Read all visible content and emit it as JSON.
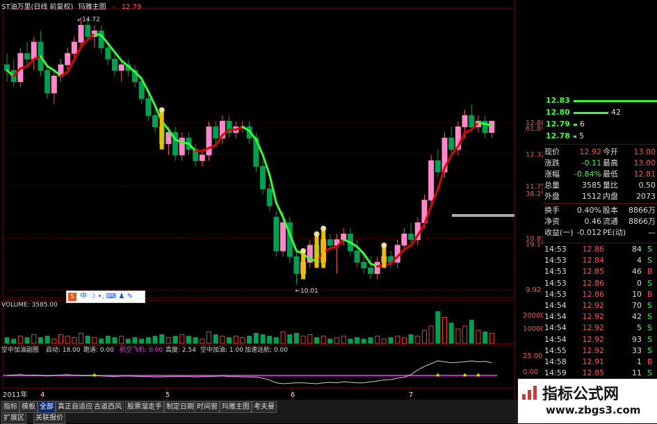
{
  "header": {
    "stock_name": "ST油万里(日线 前复权)",
    "indicator": "玛雅主图",
    "price_readout": "12.79"
  },
  "colors": {
    "up": "#ff3232",
    "down": "#00a050",
    "up_hollow": "#ff5555",
    "ma_up": "#e00000",
    "ma_down": "#33ff33",
    "grid": "#7a0000"
  },
  "chart_data": [
    {
      "type": "candlestick",
      "title": "玛雅主图",
      "y_ticks": [
        "12.88",
        "12.32",
        "11.75",
        "10.83",
        "9.92"
      ],
      "fib_labels": [
        "61.8%",
        "38.2%",
        "19.1%"
      ],
      "annotations": [
        "14.72",
        "10.01"
      ],
      "x_tick_labels": [
        "2011年",
        "4",
        "5",
        "6",
        "7"
      ],
      "ylim": [
        9.75,
        14.9
      ],
      "candles": [
        [
          13.9,
          14.1,
          13.6,
          13.8
        ],
        [
          13.8,
          14.0,
          13.5,
          13.6
        ],
        [
          13.6,
          14.2,
          13.5,
          14.1
        ],
        [
          14.1,
          14.3,
          13.9,
          14.0
        ],
        [
          14.0,
          14.4,
          13.8,
          14.3
        ],
        [
          14.3,
          14.5,
          13.7,
          13.8
        ],
        [
          13.8,
          13.9,
          13.3,
          13.4
        ],
        [
          13.4,
          13.8,
          13.2,
          13.7
        ],
        [
          13.7,
          14.0,
          13.6,
          13.9
        ],
        [
          13.9,
          14.2,
          13.8,
          14.1
        ],
        [
          14.1,
          14.4,
          14.0,
          14.3
        ],
        [
          14.3,
          14.72,
          14.2,
          14.6
        ],
        [
          14.6,
          14.7,
          14.3,
          14.4
        ],
        [
          14.4,
          14.6,
          14.2,
          14.5
        ],
        [
          14.5,
          14.6,
          14.1,
          14.2
        ],
        [
          14.2,
          14.3,
          13.9,
          14.0
        ],
        [
          14.0,
          14.1,
          13.7,
          13.8
        ],
        [
          13.8,
          14.0,
          13.6,
          13.9
        ],
        [
          13.9,
          14.0,
          13.7,
          13.8
        ],
        [
          13.8,
          13.9,
          13.5,
          13.6
        ],
        [
          13.6,
          13.7,
          13.2,
          13.3
        ],
        [
          13.3,
          13.4,
          12.9,
          13.0
        ],
        [
          13.0,
          13.2,
          12.7,
          12.8
        ],
        [
          12.8,
          13.0,
          12.4,
          12.5
        ],
        [
          12.5,
          12.8,
          12.3,
          12.7
        ],
        [
          12.7,
          12.8,
          12.2,
          12.3
        ],
        [
          12.3,
          12.7,
          12.2,
          12.6
        ],
        [
          12.6,
          12.7,
          12.3,
          12.4
        ],
        [
          12.4,
          12.5,
          12.1,
          12.2
        ],
        [
          12.2,
          12.4,
          12.1,
          12.3
        ],
        [
          12.3,
          12.9,
          12.2,
          12.8
        ],
        [
          12.8,
          12.9,
          12.5,
          12.6
        ],
        [
          12.6,
          13.0,
          12.5,
          12.9
        ],
        [
          12.9,
          13.0,
          12.6,
          12.7
        ],
        [
          12.7,
          12.9,
          12.6,
          12.8
        ],
        [
          12.8,
          12.9,
          12.7,
          12.8
        ],
        [
          12.8,
          12.9,
          12.5,
          12.6
        ],
        [
          12.6,
          12.7,
          12.0,
          12.1
        ],
        [
          12.1,
          12.2,
          11.6,
          11.7
        ],
        [
          11.7,
          11.8,
          11.3,
          11.4
        ],
        [
          11.2,
          11.3,
          10.5,
          10.6
        ],
        [
          10.6,
          11.3,
          10.5,
          11.1
        ],
        [
          11.1,
          11.2,
          10.4,
          10.5
        ],
        [
          10.5,
          10.6,
          10.01,
          10.2
        ],
        [
          10.2,
          10.5,
          10.1,
          10.4
        ],
        [
          10.4,
          10.8,
          10.3,
          10.7
        ],
        [
          10.7,
          10.8,
          10.3,
          10.4
        ],
        [
          10.4,
          10.9,
          10.3,
          10.8
        ],
        [
          10.8,
          10.9,
          10.6,
          10.7
        ],
        [
          10.7,
          10.9,
          10.2,
          10.8
        ],
        [
          10.8,
          11.0,
          10.7,
          10.9
        ],
        [
          10.9,
          11.0,
          10.5,
          10.6
        ],
        [
          10.6,
          10.8,
          10.3,
          10.4
        ],
        [
          10.4,
          10.6,
          10.2,
          10.3
        ],
        [
          10.3,
          10.5,
          10.1,
          10.2
        ],
        [
          10.2,
          10.5,
          10.1,
          10.4
        ],
        [
          10.4,
          10.6,
          10.3,
          10.5
        ],
        [
          10.5,
          10.6,
          10.3,
          10.4
        ],
        [
          10.4,
          10.8,
          10.3,
          10.7
        ],
        [
          10.7,
          11.0,
          10.6,
          10.9
        ],
        [
          10.9,
          11.1,
          10.7,
          10.8
        ],
        [
          10.8,
          11.2,
          10.7,
          11.1
        ],
        [
          11.1,
          11.6,
          11.0,
          11.5
        ],
        [
          11.5,
          12.3,
          11.4,
          12.2
        ],
        [
          12.2,
          12.4,
          11.9,
          12.0
        ],
        [
          12.0,
          12.7,
          11.9,
          12.6
        ],
        [
          12.6,
          12.8,
          12.3,
          12.4
        ],
        [
          12.4,
          12.9,
          12.3,
          12.8
        ],
        [
          12.8,
          13.1,
          12.6,
          13.0
        ],
        [
          13.0,
          13.2,
          12.7,
          12.8
        ],
        [
          12.8,
          13.0,
          12.7,
          12.9
        ],
        [
          12.9,
          13.0,
          12.6,
          12.7
        ],
        [
          12.7,
          12.9,
          12.6,
          12.9
        ]
      ],
      "volume": [
        4,
        3,
        5,
        4,
        6,
        4,
        5,
        3,
        6,
        5,
        4,
        7,
        5,
        4,
        3,
        5,
        4,
        5,
        3,
        4,
        3,
        4,
        5,
        6,
        4,
        5,
        6,
        5,
        4,
        3,
        8,
        6,
        5,
        4,
        5,
        4,
        5,
        7,
        6,
        5,
        4,
        8,
        6,
        7,
        5,
        6,
        4,
        5,
        3,
        4,
        5,
        3,
        4,
        3,
        4,
        5,
        3,
        4,
        5,
        4,
        6,
        5,
        9,
        12,
        22,
        18,
        14,
        10,
        12,
        16,
        9,
        8,
        7
      ],
      "volume_panel": {
        "label": "VOLUME: 3585.00",
        "ticks": [
          "20000",
          "10000"
        ]
      },
      "indicator_panel": {
        "title": "空中加油副图",
        "labels": [
          "启动: 18.00",
          "跑道: 0.00",
          "航空飞机: 0.00",
          "高度: 2.54",
          "空中加油: 1.00",
          "加速远航: 0.00"
        ],
        "ticks": [
          "25.00",
          "0.00"
        ],
        "line": [
          2,
          2.5,
          3,
          2,
          2.5,
          2,
          1.5,
          2,
          2.5,
          3,
          2.2,
          2,
          1.8,
          2,
          1.5,
          1.2,
          1,
          1.3,
          1.5,
          1.2,
          1,
          0.8,
          0.5,
          0.6,
          0.8,
          1,
          1.2,
          0.8,
          0.5,
          0.7,
          1,
          1.2,
          1.5,
          1,
          0.8,
          0.6,
          0.5,
          0.3,
          -1,
          -3,
          -6,
          -7,
          -6.5,
          -6,
          -6,
          -6.5,
          -7,
          -6,
          -5.5,
          -6,
          -5,
          -5.5,
          -6,
          -6,
          -5,
          -4,
          -3,
          -2.5,
          -1,
          0,
          3,
          8,
          12,
          15,
          18,
          17,
          16,
          16.5,
          17,
          18,
          17,
          17.5,
          16
        ]
      }
    }
  ],
  "quote": {
    "orderbook": [
      {
        "price": "12.83",
        "vol": "93",
        "w": 120
      },
      {
        "price": "12.80",
        "vol": "42",
        "w": 50
      },
      {
        "price": "12.79",
        "vol": "6",
        "w": 5
      },
      {
        "price": "12.78",
        "vol": "5",
        "w": 4
      }
    ],
    "stats": [
      [
        "现价",
        "12.92",
        "今开",
        "13.00"
      ],
      [
        "涨跌",
        "-0.11",
        "最高",
        "13.00"
      ],
      [
        "涨幅",
        "-0.84%",
        "最低",
        "12.81"
      ],
      [
        "总量",
        "3585",
        "量比",
        "0.50"
      ],
      [
        "外盘",
        "1512",
        "内盘",
        "2073"
      ],
      [
        "换手",
        "0.40%",
        "股本",
        "8866万"
      ],
      [
        "净资",
        "0.46",
        "流通",
        "8866万"
      ],
      [
        "收益(一)",
        "-0.012",
        "PE(动)",
        "—"
      ]
    ],
    "trades": [
      [
        "14:53",
        "12.86",
        "84",
        "S"
      ],
      [
        "14:53",
        "12.84",
        "4",
        "S"
      ],
      [
        "14:53",
        "12.85",
        "46",
        "B"
      ],
      [
        "14:53",
        "12.86",
        "0",
        "S"
      ],
      [
        "14:53",
        "12.86",
        "10",
        "B"
      ],
      [
        "14:54",
        "12.92",
        "70",
        "S"
      ],
      [
        "14:54",
        "12.92",
        "42",
        "S"
      ],
      [
        "14:54",
        "12.92",
        "5",
        "S"
      ],
      [
        "14:54",
        "12.92",
        "93",
        "S"
      ],
      [
        "14:55",
        "12.92",
        "33",
        "S"
      ],
      [
        "14:58",
        "12.91",
        "1",
        "B"
      ],
      [
        "14:59",
        "12.85",
        "11",
        "S"
      ],
      [
        "14:59",
        "12.92",
        "48",
        "B"
      ],
      [
        "15:00",
        "12.92",
        "26",
        "B"
      ]
    ]
  },
  "tabs": {
    "row1": [
      "指标",
      "模板",
      "全部",
      "真正自适应",
      "古道西风",
      "股票溜走手",
      "制定日期",
      "时间窗",
      "玛雅主图",
      "考夫曼"
    ],
    "row2": [
      "扩展区",
      "关联报价"
    ]
  },
  "ime": {
    "label": "中"
  },
  "watermark": {
    "line1": "指标公式网",
    "line2": "www.zbgs3.com"
  }
}
